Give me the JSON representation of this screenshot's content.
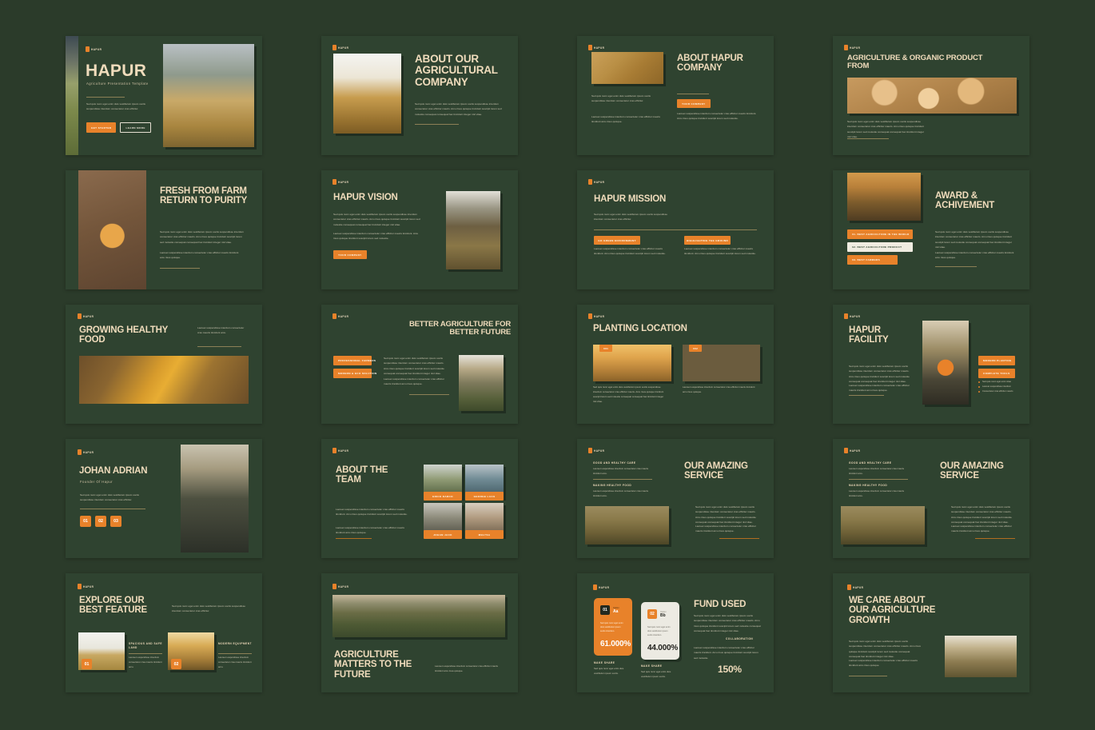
{
  "meta": {
    "logo_word": "HAPUR",
    "accent": "#e8822a",
    "bg": "#2b3b2a",
    "slide_bg": "#2f4330",
    "heading_color": "#f0dcbc"
  },
  "lorem": {
    "p1": "Sed quis nunc eget enim duis vestibulum ipsum sociis suspendisse interdum consectetur cras efficitur mauris. Arcu risus quisque tincidunt suscipit lorem sed molestie consequat consequat hac tincidunt integer nisl vitae.",
    "p2": "Laoreet suspendisse interdum consectetur cras efficitur mauris tincidunt. Arcu risus quisque tincidunt suscipit lorem sed molestie.",
    "p3": "Sed quis nunc eget enim duis vestibulum ipsum sociis suspendisse interdum consectetur cras efficitur.",
    "p4": "Laoreet suspendisse interdum consectetur cras efficitur mauris tincidunt arcu risus quisque.",
    "short": "Laoreet suspendisse interdum consectetur cras mauris tincidunt arcu."
  },
  "slides": [
    {
      "id": "cover",
      "title": "HAPUR",
      "subtitle": "Agriculture Presentation Template",
      "buttons": [
        "GET STARTED",
        "LEARN MORE"
      ]
    },
    {
      "id": "about-our-agricultural-company",
      "title": "ABOUT OUR AGRICULTURAL COMPANY"
    },
    {
      "id": "about-hapur-company",
      "title": "ABOUT HAPUR COMPANY",
      "button": "YOUR COMPANY"
    },
    {
      "id": "agriculture-organic-product",
      "title": "AGRICULTURE & ORGANIC PRODUCT FROM"
    },
    {
      "id": "fresh-from-farm",
      "title": "FRESH FROM FARM RETURN TO PURITY"
    },
    {
      "id": "hapur-vision",
      "title": "HAPUR VISION",
      "button": "YOUR COMPANY"
    },
    {
      "id": "hapur-mission",
      "title": "HAPUR MISSION",
      "badges": [
        "GO GREEN ENVIRONMENT",
        "HIGHLIGHTING THE GROUND"
      ]
    },
    {
      "id": "award-achievement",
      "title": "AWARD & ACHIVEMENT",
      "awards": [
        "01. BEST AGRICULTURE IN THE WORLD",
        "02. BEST AGRICULTURE PRODUCT",
        "03. BEST FARMERS"
      ]
    },
    {
      "id": "growing-healthy-food",
      "title": "GROWING HEALTHY FOOD"
    },
    {
      "id": "better-agriculture",
      "title": "BETTER AGRICULTURE FOR BETTER FUTURE",
      "badges": [
        "PROFESSIONAL FARMERS",
        "MODERN & ECO SOLUTION"
      ]
    },
    {
      "id": "planting-location",
      "title": "PLANTING LOCATION",
      "tags": [
        "001",
        "002"
      ]
    },
    {
      "id": "hapur-facility",
      "title": "HAPUR FACILITY",
      "badges": [
        "MODERN PLANTING",
        "COMPLETE TOOLS"
      ],
      "bullets": [
        "Sed quis nunc eget enim vitae",
        "Laoreet suspendisse interdum",
        "Consectetur cras efficitur mauris"
      ]
    },
    {
      "id": "johan-adrian",
      "title": "JOHAN ADRIAN",
      "role": "Founder Of Hapur",
      "numbers": [
        "01",
        "02",
        "03"
      ]
    },
    {
      "id": "about-the-team",
      "title": "ABOUT THE TEAM",
      "members": [
        "ERICK DARCO",
        "GEORGE LUAS",
        "JOHAN JACK",
        "MELYSA"
      ]
    },
    {
      "id": "our-amazing-service-a",
      "title": "OUR AMAZING SERVICE",
      "features": [
        "GOOD AND HEALTHY CARE",
        "MAKING HEALTHY FOOD"
      ]
    },
    {
      "id": "our-amazing-service-b",
      "title": "OUR AMAZING SERVICE",
      "features": [
        "GOOD AND HEALTHY CARE",
        "MAKING HEALTHY FOOD"
      ]
    },
    {
      "id": "explore-best-feature",
      "title": "EXPLORE OUR BEST FEATURE",
      "features": [
        {
          "num": "01",
          "label": "SPACIOUS AND SAFE LAND"
        },
        {
          "num": "02",
          "label": "MODERN EQUIPMENT"
        }
      ]
    },
    {
      "id": "agriculture-matters",
      "title": "AGRICULTURE MATTERS TO THE FUTURE"
    },
    {
      "id": "fund-used",
      "title": "FUND USED",
      "section_label": "COLLABORATION",
      "total": "150%",
      "cards": [
        {
          "num": "01",
          "option_label": "Option",
          "option": "Aa",
          "desc": "Sed quis nunc eget enim duis vestibulum ipsum sociis interdum.",
          "value": "61.000%",
          "foot_title": "MAKE SHARE",
          "foot_desc": "Sed quis nunc eget enim duis vestibulum ipsum sociis."
        },
        {
          "num": "02",
          "option_label": "Option",
          "option": "Bb",
          "desc": "Sed quis nunc eget enim duis vestibulum ipsum sociis interdum.",
          "value": "44.000%",
          "foot_title": "MAKE SHARE",
          "foot_desc": "Sed quis nunc eget enim duis vestibulum ipsum sociis."
        }
      ]
    },
    {
      "id": "we-care-about",
      "title": "WE CARE ABOUT OUR AGRICULTURE GROWTH"
    }
  ]
}
